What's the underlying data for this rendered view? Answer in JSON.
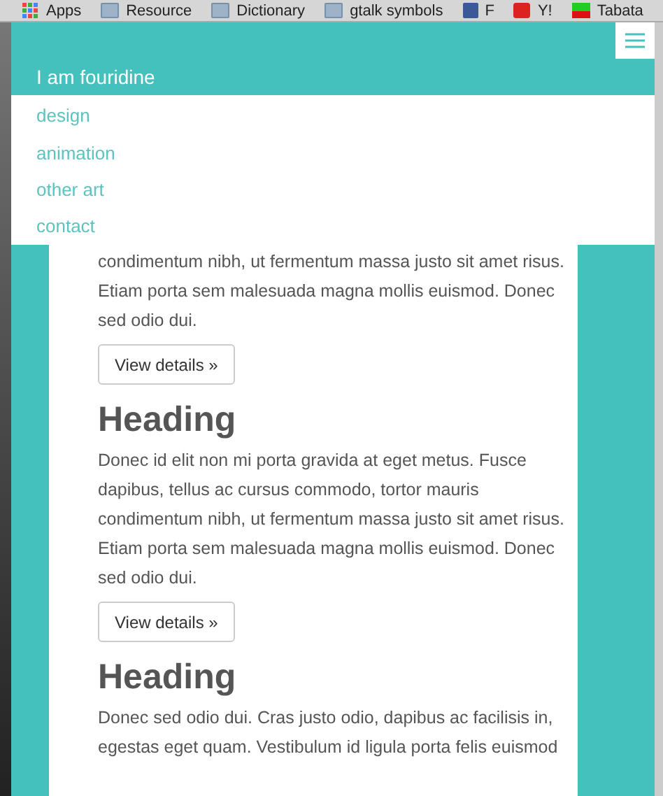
{
  "bookmarks": [
    {
      "label": "Apps",
      "kind": "apps"
    },
    {
      "label": "Resource",
      "kind": "folder"
    },
    {
      "label": "Dictionary",
      "kind": "folder"
    },
    {
      "label": "gtalk symbols",
      "kind": "folder"
    },
    {
      "label": "F",
      "kind": "facebook"
    },
    {
      "label": "Y!",
      "kind": "video"
    },
    {
      "label": "Tabata",
      "kind": "flag"
    }
  ],
  "navbar": {
    "brand": "I am fouridine",
    "menu": [
      {
        "label": "design"
      },
      {
        "label": "animation"
      },
      {
        "label": "other art"
      },
      {
        "label": "contact"
      }
    ]
  },
  "sections": [
    {
      "text": "condimentum nibh, ut fermentum massa justo sit amet risus. Etiam porta sem malesuada magna mollis euismod. Donec sed odio dui.",
      "button": "View details »"
    },
    {
      "heading": "Heading",
      "text": "Donec id elit non mi porta gravida at eget metus. Fusce dapibus, tellus ac cursus commodo, tortor mauris condimentum nibh, ut fermentum massa justo sit amet risus. Etiam porta sem malesuada magna mollis euismod. Donec sed odio dui.",
      "button": "View details »"
    },
    {
      "heading": "Heading",
      "text": "Donec sed odio dui. Cras justo odio, dapibus ac facilisis in, egestas eget quam. Vestibulum id ligula porta felis euismod"
    }
  ]
}
